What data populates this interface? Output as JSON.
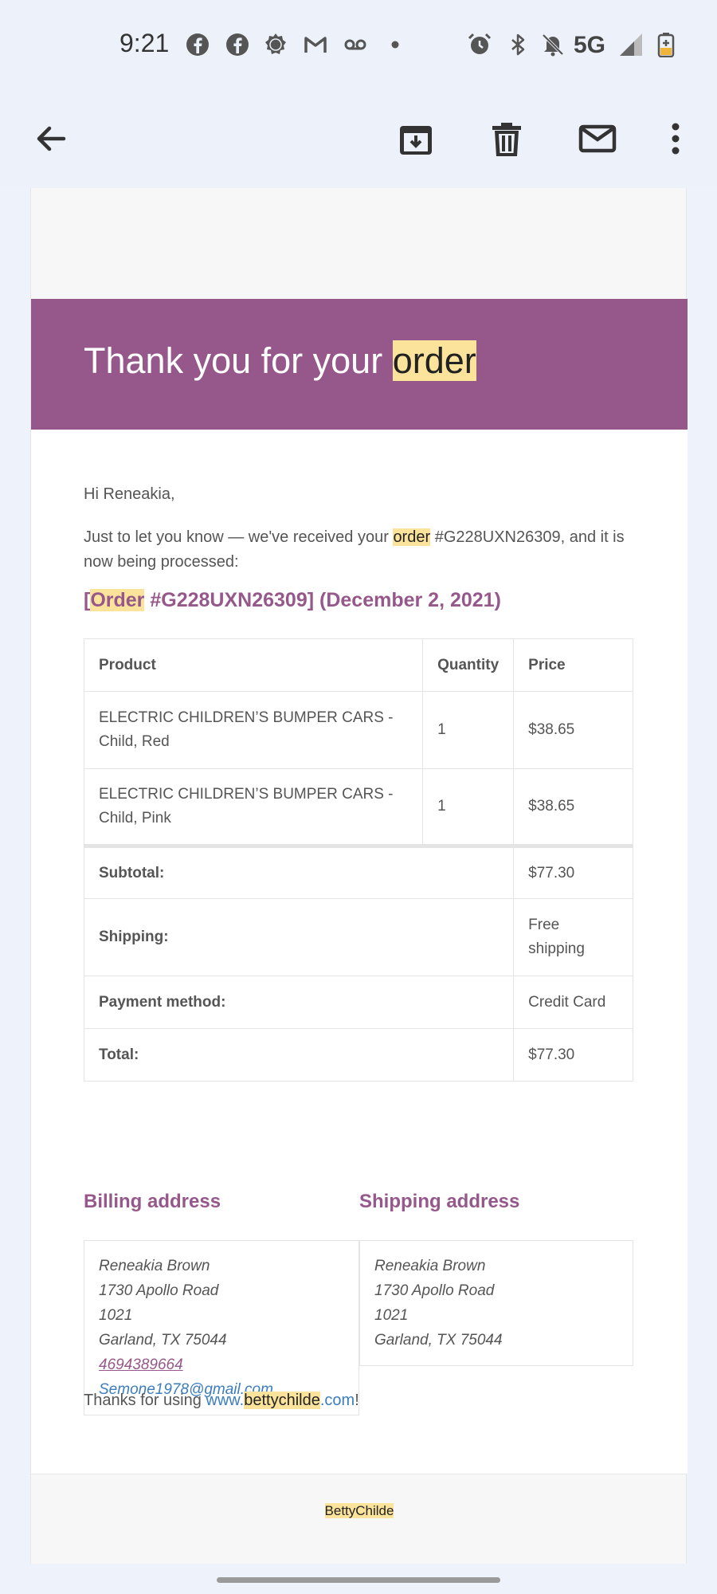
{
  "status_bar": {
    "time": "9:21",
    "network": "5G",
    "icons": [
      "facebook-icon",
      "facebook-icon",
      "settings-sun-icon",
      "gmail-icon",
      "voicemail-icon",
      "dot-icon",
      "alarm-icon",
      "bluetooth-icon",
      "mute-icon",
      "signal-icon",
      "battery-icon"
    ]
  },
  "toolbar": {
    "icons": [
      "back-arrow-icon",
      "archive-icon",
      "delete-icon",
      "mark-unread-icon",
      "more-vert-icon"
    ]
  },
  "email": {
    "header": {
      "title_prefix": "Thank you for your ",
      "title_highlight": "order",
      "background": "#96588a"
    },
    "greeting": "Hi Reneakia,",
    "intro_before": "Just to let you know — we've received your ",
    "intro_highlight": "order",
    "intro_after": " #G228UXN26309, and it is now being processed:",
    "order_heading": {
      "bracket_open": "[",
      "highlight": "Order",
      "rest": " #G228UXN26309] (December 2, 2021)"
    },
    "table": {
      "headers": [
        "Product",
        "Quantity",
        "Price"
      ],
      "items": [
        {
          "product": "ELECTRIC CHILDREN’S BUMPER CARS - Child, Red",
          "quantity": "1",
          "price": "$38.65"
        },
        {
          "product": "ELECTRIC CHILDREN’S BUMPER CARS - Child, Pink",
          "quantity": "1",
          "price": "$38.65"
        }
      ],
      "totals": [
        {
          "label": "Subtotal:",
          "value": "$77.30"
        },
        {
          "label": "Shipping:",
          "value": "Free shipping"
        },
        {
          "label": "Payment method:",
          "value": "Credit Card"
        },
        {
          "label": "Total:",
          "value": "$77.30"
        }
      ]
    },
    "billing": {
      "title": "Billing address",
      "name": "Reneakia Brown",
      "street": "1730 Apollo Road",
      "unit": "1021",
      "city": "Garland, TX 75044",
      "phone": "4694389664",
      "email": "Semone1978@gmail.com"
    },
    "shipping": {
      "title": "Shipping address",
      "name": "Reneakia Brown",
      "street": "1730 Apollo Road",
      "unit": "1021",
      "city": "Garland, TX 75044"
    },
    "thanks": {
      "before": "Thanks for using ",
      "link_prefix": "www.",
      "link_highlight": "bettychilde",
      "link_suffix": ".com",
      "after": "!"
    },
    "footer_brand": "BettyChilde",
    "accent_color": "#96588a",
    "highlight_color": "#fce39b",
    "link_color": "#3c7dbe"
  }
}
